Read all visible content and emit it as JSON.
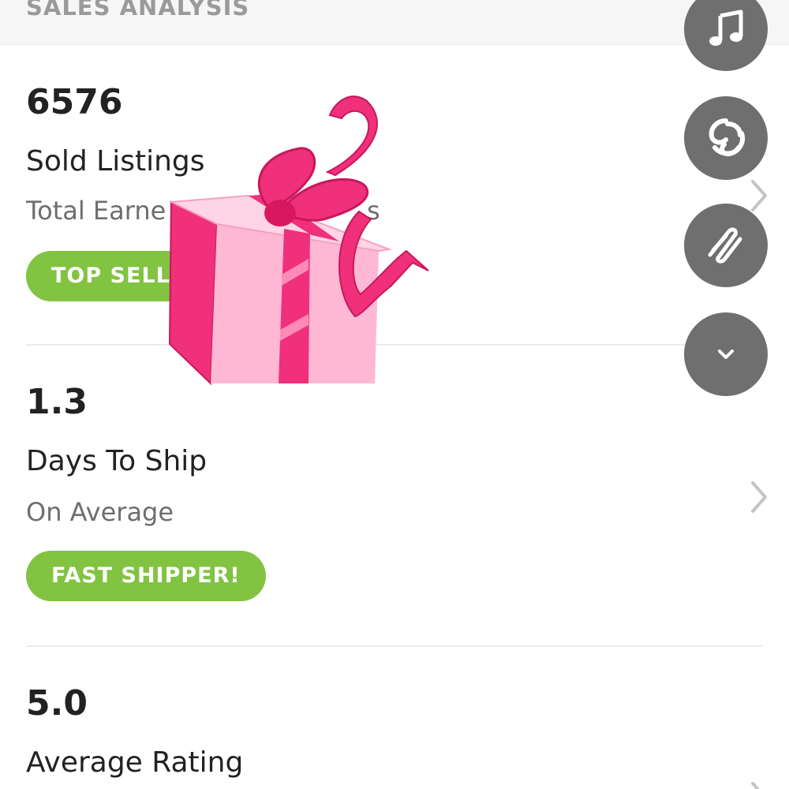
{
  "header": {
    "title": "SALES ANALYSIS"
  },
  "stats": [
    {
      "value": "6576",
      "label": "Sold Listings",
      "sub": "Total Earne",
      "sub_tail": "s",
      "badge": "TOP SELL"
    },
    {
      "value": "1.3",
      "label": "Days To Ship",
      "sub": "On Average",
      "badge": "FAST SHIPPER!"
    },
    {
      "value": "5.0",
      "label": "Average Rating"
    }
  ],
  "floating_buttons": [
    {
      "icon": "music-note-icon"
    },
    {
      "icon": "spiral-icon"
    },
    {
      "icon": "scribble-icon"
    },
    {
      "icon": "chevron-down-icon"
    }
  ],
  "colors": {
    "badge": "#82c341",
    "fab": "#6f6f6f",
    "gift_pink": "#f0307a",
    "gift_light": "#ffb8d4"
  }
}
